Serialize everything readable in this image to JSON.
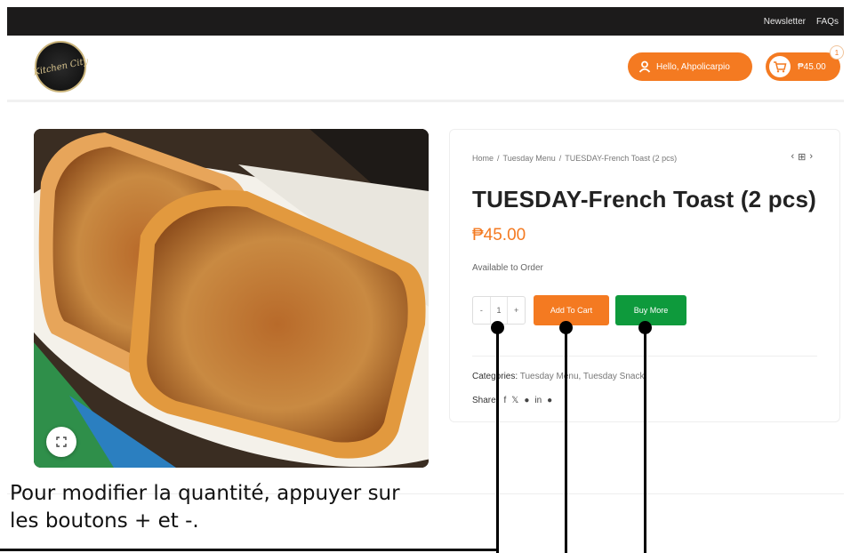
{
  "topbar": {
    "newsletter": "Newsletter",
    "faqs": "FAQs"
  },
  "header": {
    "logo_text": "Kitchen City",
    "hello_label": "Hello, Ahpolicarpio",
    "cart_total": "₱45.00",
    "cart_count": "1"
  },
  "product": {
    "breadcrumb": [
      "Home",
      "Tuesday Menu",
      "TUESDAY-French Toast (2 pcs)"
    ],
    "title": "TUESDAY-French Toast (2 pcs)",
    "price": "₱45.00",
    "stock_status": "Available to Order",
    "quantity": {
      "minus": "-",
      "value": "1",
      "plus": "+"
    },
    "add_to_cart_label": "Add To Cart",
    "buy_more_label": "Buy More",
    "categories_label": "Categories:",
    "categories": "Tuesday Menu, Tuesday Snack",
    "share_label": "Share:",
    "share_icons": [
      "facebook-icon",
      "x-icon",
      "pinterest-icon",
      "linkedin-icon",
      "telegram-icon"
    ]
  },
  "annotation": {
    "text": "Pour modifier la quantité, appuyer sur les boutons + et -."
  },
  "colors": {
    "accent_orange": "#f47a21",
    "buy_green": "#0e9a3c",
    "topbar_dark": "#1c1b1b"
  }
}
